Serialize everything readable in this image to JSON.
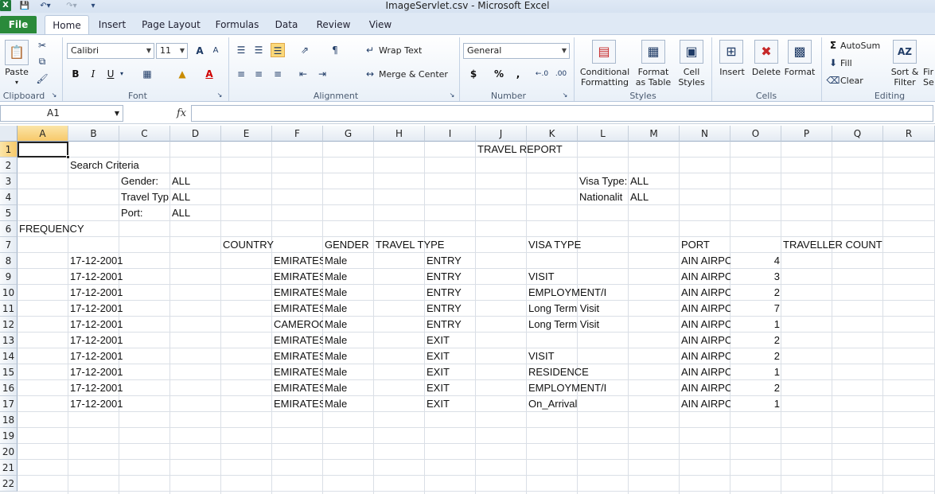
{
  "window": {
    "title": "ImageServlet.csv  -  Microsoft Excel"
  },
  "tabs": [
    "File",
    "Home",
    "Insert",
    "Page Layout",
    "Formulas",
    "Data",
    "Review",
    "View"
  ],
  "ribbon": {
    "clipboard": {
      "label": "Clipboard",
      "paste": "Paste"
    },
    "font": {
      "label": "Font",
      "name": "Calibri",
      "size": "11",
      "bold": "B",
      "italic": "I",
      "underline": "U",
      "grow": "A",
      "shrink": "A"
    },
    "alignment": {
      "label": "Alignment",
      "wrap_text": "Wrap Text",
      "merge_center": "Merge & Center"
    },
    "number": {
      "label": "Number",
      "format": "General",
      "currency": "$",
      "percent": "%",
      "comma": ","
    },
    "styles": {
      "label": "Styles",
      "conditional": [
        "Conditional",
        "Formatting"
      ],
      "format_table": [
        "Format",
        "as Table"
      ],
      "cell_styles": [
        "Cell",
        "Styles"
      ]
    },
    "cells": {
      "label": "Cells",
      "insert": "Insert",
      "delete": "Delete",
      "format": "Format"
    },
    "editing": {
      "label": "Editing",
      "autosum": "AutoSum",
      "fill": "Fill",
      "clear": "Clear",
      "sort": [
        "Sort &",
        "Filter"
      ],
      "find": [
        "Fir",
        "Se"
      ]
    }
  },
  "formula_bar": {
    "name_box": "A1",
    "fx": "fx",
    "value": ""
  },
  "columns": [
    "A",
    "B",
    "C",
    "D",
    "E",
    "F",
    "G",
    "H",
    "I",
    "J",
    "K",
    "L",
    "M",
    "N",
    "O",
    "P",
    "Q",
    "R"
  ],
  "rows": [
    "1",
    "2",
    "3",
    "4",
    "5",
    "6",
    "7",
    "8",
    "9",
    "10",
    "11",
    "12",
    "13",
    "14",
    "15",
    "16",
    "17",
    "18",
    "19",
    "20",
    "21",
    "22"
  ],
  "cells": [
    {
      "ref": "J1",
      "text": "TRAVEL REPORT"
    },
    {
      "ref": "B2",
      "text": "Search Criteria"
    },
    {
      "ref": "C3",
      "text": "Gender:"
    },
    {
      "ref": "D3",
      "text": "ALL"
    },
    {
      "ref": "L3",
      "text": "Visa Type:"
    },
    {
      "ref": "M3",
      "text": "ALL"
    },
    {
      "ref": "C4",
      "text": "Travel Typ"
    },
    {
      "ref": "D4",
      "text": "ALL"
    },
    {
      "ref": "L4",
      "text": "Nationalit"
    },
    {
      "ref": "M4",
      "text": "ALL"
    },
    {
      "ref": "C5",
      "text": "Port:"
    },
    {
      "ref": "D5",
      "text": "ALL"
    },
    {
      "ref": "A6",
      "text": "FREQUENCY"
    },
    {
      "ref": "E7",
      "text": "COUNTRY"
    },
    {
      "ref": "G7",
      "text": "GENDER"
    },
    {
      "ref": "H7",
      "text": "TRAVEL TYPE"
    },
    {
      "ref": "K7",
      "text": "VISA TYPE"
    },
    {
      "ref": "N7",
      "text": "PORT"
    },
    {
      "ref": "P7",
      "text": "TRAVELLER COUNT"
    },
    {
      "ref": "B8",
      "text": "17-12-2001"
    },
    {
      "ref": "F8",
      "text": "EMIRATES"
    },
    {
      "ref": "G8",
      "text": "Male"
    },
    {
      "ref": "I8",
      "text": "ENTRY"
    },
    {
      "ref": "N8",
      "text": "AIN AIRPC"
    },
    {
      "ref": "O8",
      "text": "4",
      "num": true
    },
    {
      "ref": "B9",
      "text": "17-12-2001"
    },
    {
      "ref": "F9",
      "text": "EMIRATES"
    },
    {
      "ref": "G9",
      "text": "Male"
    },
    {
      "ref": "I9",
      "text": "ENTRY"
    },
    {
      "ref": "K9",
      "text": "VISIT"
    },
    {
      "ref": "N9",
      "text": "AIN AIRPC"
    },
    {
      "ref": "O9",
      "text": "3",
      "num": true
    },
    {
      "ref": "B10",
      "text": "17-12-2001"
    },
    {
      "ref": "F10",
      "text": "EMIRATES"
    },
    {
      "ref": "G10",
      "text": "Male"
    },
    {
      "ref": "I10",
      "text": "ENTRY"
    },
    {
      "ref": "K10",
      "text": "EMPLOYMENT/I"
    },
    {
      "ref": "N10",
      "text": "AIN AIRPC"
    },
    {
      "ref": "O10",
      "text": "2",
      "num": true
    },
    {
      "ref": "B11",
      "text": "17-12-2001"
    },
    {
      "ref": "F11",
      "text": "EMIRATES"
    },
    {
      "ref": "G11",
      "text": "Male"
    },
    {
      "ref": "I11",
      "text": "ENTRY"
    },
    {
      "ref": "K11",
      "text": "Long Term Visit"
    },
    {
      "ref": "N11",
      "text": "AIN AIRPC"
    },
    {
      "ref": "O11",
      "text": "7",
      "num": true
    },
    {
      "ref": "B12",
      "text": "17-12-2001"
    },
    {
      "ref": "F12",
      "text": "CAMEROO"
    },
    {
      "ref": "G12",
      "text": "Male"
    },
    {
      "ref": "I12",
      "text": "ENTRY"
    },
    {
      "ref": "K12",
      "text": "Long Term Visit"
    },
    {
      "ref": "N12",
      "text": "AIN AIRPC"
    },
    {
      "ref": "O12",
      "text": "1",
      "num": true
    },
    {
      "ref": "B13",
      "text": "17-12-2001"
    },
    {
      "ref": "F13",
      "text": "EMIRATES"
    },
    {
      "ref": "G13",
      "text": "Male"
    },
    {
      "ref": "I13",
      "text": "EXIT"
    },
    {
      "ref": "N13",
      "text": "AIN AIRPC"
    },
    {
      "ref": "O13",
      "text": "2",
      "num": true
    },
    {
      "ref": "B14",
      "text": "17-12-2001"
    },
    {
      "ref": "F14",
      "text": "EMIRATES"
    },
    {
      "ref": "G14",
      "text": "Male"
    },
    {
      "ref": "I14",
      "text": "EXIT"
    },
    {
      "ref": "K14",
      "text": "VISIT"
    },
    {
      "ref": "N14",
      "text": "AIN AIRPC"
    },
    {
      "ref": "O14",
      "text": "2",
      "num": true
    },
    {
      "ref": "B15",
      "text": "17-12-2001"
    },
    {
      "ref": "F15",
      "text": "EMIRATES"
    },
    {
      "ref": "G15",
      "text": "Male"
    },
    {
      "ref": "I15",
      "text": "EXIT"
    },
    {
      "ref": "K15",
      "text": "RESIDENCE"
    },
    {
      "ref": "N15",
      "text": "AIN AIRPC"
    },
    {
      "ref": "O15",
      "text": "1",
      "num": true
    },
    {
      "ref": "B16",
      "text": "17-12-2001"
    },
    {
      "ref": "F16",
      "text": "EMIRATES"
    },
    {
      "ref": "G16",
      "text": "Male"
    },
    {
      "ref": "I16",
      "text": "EXIT"
    },
    {
      "ref": "K16",
      "text": "EMPLOYMENT/I"
    },
    {
      "ref": "N16",
      "text": "AIN AIRPC"
    },
    {
      "ref": "O16",
      "text": "2",
      "num": true
    },
    {
      "ref": "B17",
      "text": "17-12-2001"
    },
    {
      "ref": "F17",
      "text": "EMIRATES"
    },
    {
      "ref": "G17",
      "text": "Male"
    },
    {
      "ref": "I17",
      "text": "EXIT"
    },
    {
      "ref": "K17",
      "text": "On_Arrival"
    },
    {
      "ref": "N17",
      "text": "AIN AIRPC"
    },
    {
      "ref": "O17",
      "text": "1",
      "num": true
    }
  ]
}
